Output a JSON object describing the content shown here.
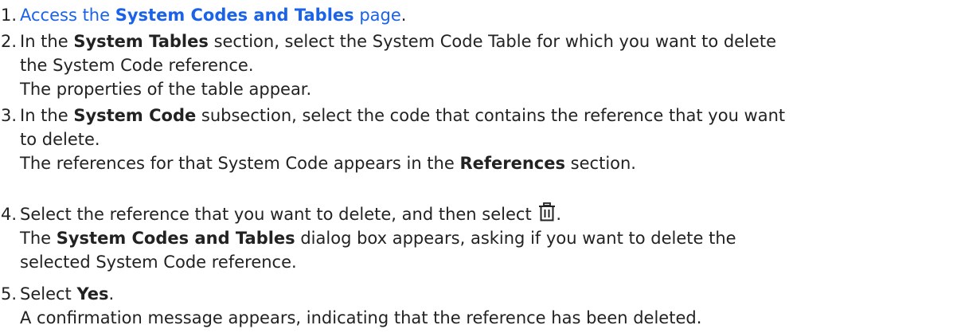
{
  "colors": {
    "text": "#222222",
    "link": "#1a62e8"
  },
  "steps": [
    {
      "number": "1.",
      "prefix": "Access the ",
      "link_bold": "System Codes and Tables",
      "link_suffix": " page",
      "suffix": "."
    },
    {
      "number": "2.",
      "text_a": "In the ",
      "bold_a": "System Tables",
      "text_b": " section, select the System Code Table for which you want to delete",
      "line2": "the System Code reference.",
      "result": "The properties of the table appear."
    },
    {
      "number": "3.",
      "text_a": "In the ",
      "bold_a": "System Code",
      "text_b": " subsection, select the code that contains the reference that you want",
      "line2": "to delete.",
      "result_a": "The references for that System Code appears in the ",
      "result_bold": "References",
      "result_b": " section."
    },
    {
      "number": "4.",
      "text_a": "Select the reference that you want to delete, and then select ",
      "icon": "trash-icon",
      "text_b": ".",
      "result_a": "The ",
      "result_bold": "System Codes and Tables",
      "result_b": " dialog box appears, asking if you want to delete the",
      "result_line2": "selected System Code reference."
    },
    {
      "number": "5.",
      "text_a": "Select ",
      "bold_a": "Yes",
      "text_b": ".",
      "result": "A confirmation message appears, indicating that the reference has been deleted."
    }
  ]
}
